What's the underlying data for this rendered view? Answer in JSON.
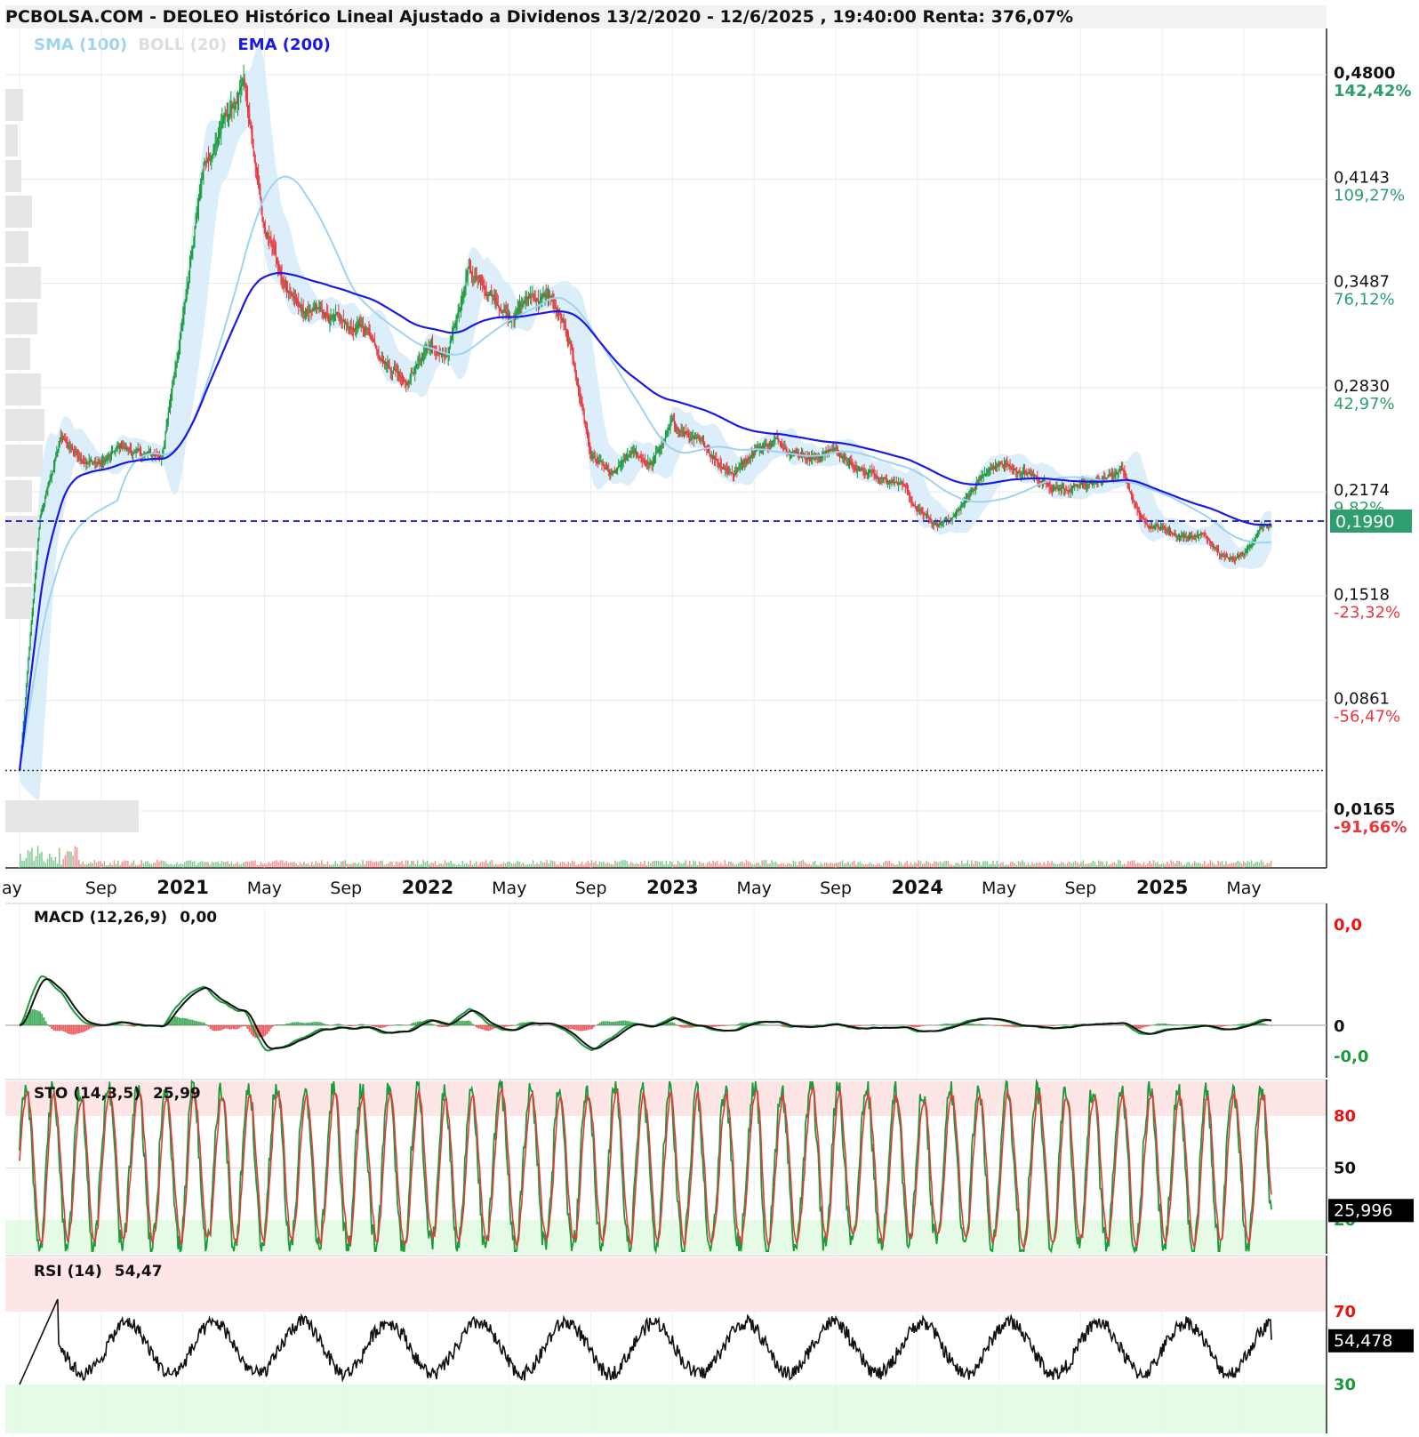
{
  "title": "PCBOLSA.COM - DEOLEO Histórico Lineal Ajustado a Dividenos 13/2/2020 - 12/6/2025 , 19:40:00 Renta: 376,07%",
  "legend": [
    {
      "label": "SMA (100)",
      "color": "#9fd3f2"
    },
    {
      "label": "BOLL (20)",
      "color": "#dddddd"
    },
    {
      "label": "EMA (200)",
      "color": "#1a1ae6"
    }
  ],
  "colors": {
    "up": "#1a9a3a",
    "down": "#e8383d",
    "ema": "#1a1ae6",
    "sma": "#9fd3f2",
    "band": "#d6ebf8",
    "price_tag": "#2e9e6e",
    "pct_up": "#2e9e6e",
    "pct_down": "#e8383d"
  },
  "chart_data": [
    {
      "type": "candlestick",
      "name": "price",
      "ylim": [
        0.0165,
        0.48
      ],
      "price_labels": [
        {
          "value": "0,4800",
          "pct": "142,42%",
          "dir": "up",
          "bold": true
        },
        {
          "value": "0,4143",
          "pct": "109,27%",
          "dir": "up",
          "bold": false
        },
        {
          "value": "0,3487",
          "pct": "76,12%",
          "dir": "up",
          "bold": false
        },
        {
          "value": "0,2830",
          "pct": "42,97%",
          "dir": "up",
          "bold": false
        },
        {
          "value": "0,2174",
          "pct": "9,82%",
          "dir": "up",
          "bold": false
        },
        {
          "value": "0,1518",
          "pct": "-23,32%",
          "dir": "down",
          "bold": false
        },
        {
          "value": "0,0861",
          "pct": "-56,47%",
          "dir": "down",
          "bold": false
        },
        {
          "value": "0,0165",
          "pct": "-91,66%",
          "dir": "down",
          "bold": true
        }
      ],
      "last_price": "0,1990",
      "last_price_value": 0.199,
      "reference_line": 0.042,
      "x_ticks": [
        {
          "label": "ay",
          "bold": false
        },
        {
          "label": "Sep",
          "bold": false
        },
        {
          "label": "2021",
          "bold": true
        },
        {
          "label": "May",
          "bold": false
        },
        {
          "label": "Sep",
          "bold": false
        },
        {
          "label": "2022",
          "bold": true
        },
        {
          "label": "May",
          "bold": false
        },
        {
          "label": "Sep",
          "bold": false
        },
        {
          "label": "2023",
          "bold": true
        },
        {
          "label": "May",
          "bold": false
        },
        {
          "label": "Sep",
          "bold": false
        },
        {
          "label": "2024",
          "bold": true
        },
        {
          "label": "May",
          "bold": false
        },
        {
          "label": "Sep",
          "bold": false
        },
        {
          "label": "2025",
          "bold": true
        },
        {
          "label": "May",
          "bold": false
        }
      ],
      "close_path": [
        [
          "2020-05",
          0.042
        ],
        [
          "2020-06",
          0.2
        ],
        [
          "2020-07",
          0.25
        ],
        [
          "2020-08",
          0.24
        ],
        [
          "2020-09",
          0.235
        ],
        [
          "2020-10",
          0.245
        ],
        [
          "2020-11",
          0.24
        ],
        [
          "2020-12",
          0.24
        ],
        [
          "2021-01",
          0.33
        ],
        [
          "2021-02",
          0.42
        ],
        [
          "2021-03",
          0.45
        ],
        [
          "2021-04",
          0.47
        ],
        [
          "2021-05",
          0.38
        ],
        [
          "2021-06",
          0.35
        ],
        [
          "2021-07",
          0.33
        ],
        [
          "2021-08",
          0.33
        ],
        [
          "2021-09",
          0.32
        ],
        [
          "2021-10",
          0.32
        ],
        [
          "2021-11",
          0.3
        ],
        [
          "2021-12",
          0.29
        ],
        [
          "2022-01",
          0.31
        ],
        [
          "2022-02",
          0.3
        ],
        [
          "2022-03",
          0.36
        ],
        [
          "2022-04",
          0.34
        ],
        [
          "2022-05",
          0.33
        ],
        [
          "2022-06",
          0.34
        ],
        [
          "2022-07",
          0.34
        ],
        [
          "2022-08",
          0.31
        ],
        [
          "2022-09",
          0.24
        ],
        [
          "2022-10",
          0.225
        ],
        [
          "2022-11",
          0.24
        ],
        [
          "2022-12",
          0.235
        ],
        [
          "2023-01",
          0.26
        ],
        [
          "2023-02",
          0.25
        ],
        [
          "2023-03",
          0.24
        ],
        [
          "2023-04",
          0.23
        ],
        [
          "2023-05",
          0.245
        ],
        [
          "2023-06",
          0.25
        ],
        [
          "2023-07",
          0.245
        ],
        [
          "2023-08",
          0.24
        ],
        [
          "2023-09",
          0.245
        ],
        [
          "2023-10",
          0.23
        ],
        [
          "2023-11",
          0.23
        ],
        [
          "2023-12",
          0.225
        ],
        [
          "2024-01",
          0.205
        ],
        [
          "2024-02",
          0.195
        ],
        [
          "2024-03",
          0.205
        ],
        [
          "2024-04",
          0.225
        ],
        [
          "2024-05",
          0.235
        ],
        [
          "2024-06",
          0.23
        ],
        [
          "2024-07",
          0.225
        ],
        [
          "2024-08",
          0.22
        ],
        [
          "2024-09",
          0.22
        ],
        [
          "2024-10",
          0.225
        ],
        [
          "2024-11",
          0.23
        ],
        [
          "2024-12",
          0.2
        ],
        [
          "2025-01",
          0.195
        ],
        [
          "2025-02",
          0.19
        ],
        [
          "2025-03",
          0.19
        ],
        [
          "2025-04",
          0.175
        ],
        [
          "2025-05",
          0.18
        ],
        [
          "2025-06",
          0.199
        ]
      ]
    },
    {
      "type": "line",
      "name": "MACD (12,26,9)",
      "value": "0,00",
      "y_labels": [
        {
          "label": "0,0",
          "color": "#e11"
        },
        {
          "label": "0",
          "color": "#111"
        },
        {
          "label": "-0,0",
          "color": "#1a9a3a"
        }
      ]
    },
    {
      "type": "line",
      "name": "STO (14,3,5)",
      "value": "25,99",
      "current": "25,996",
      "current_value": 25.996,
      "levels": [
        80,
        50,
        20
      ],
      "y_labels": [
        {
          "label": "80",
          "color": "#e11"
        },
        {
          "label": "50",
          "color": "#111"
        },
        {
          "label": "20",
          "color": "#1a9a3a"
        }
      ]
    },
    {
      "type": "line",
      "name": "RSI (14)",
      "value": "54,47",
      "current": "54,478",
      "current_value": 54.478,
      "levels": [
        70,
        30
      ],
      "y_labels": [
        {
          "label": "70",
          "color": "#e11"
        },
        {
          "label": "30",
          "color": "#1a9a3a"
        }
      ]
    }
  ]
}
